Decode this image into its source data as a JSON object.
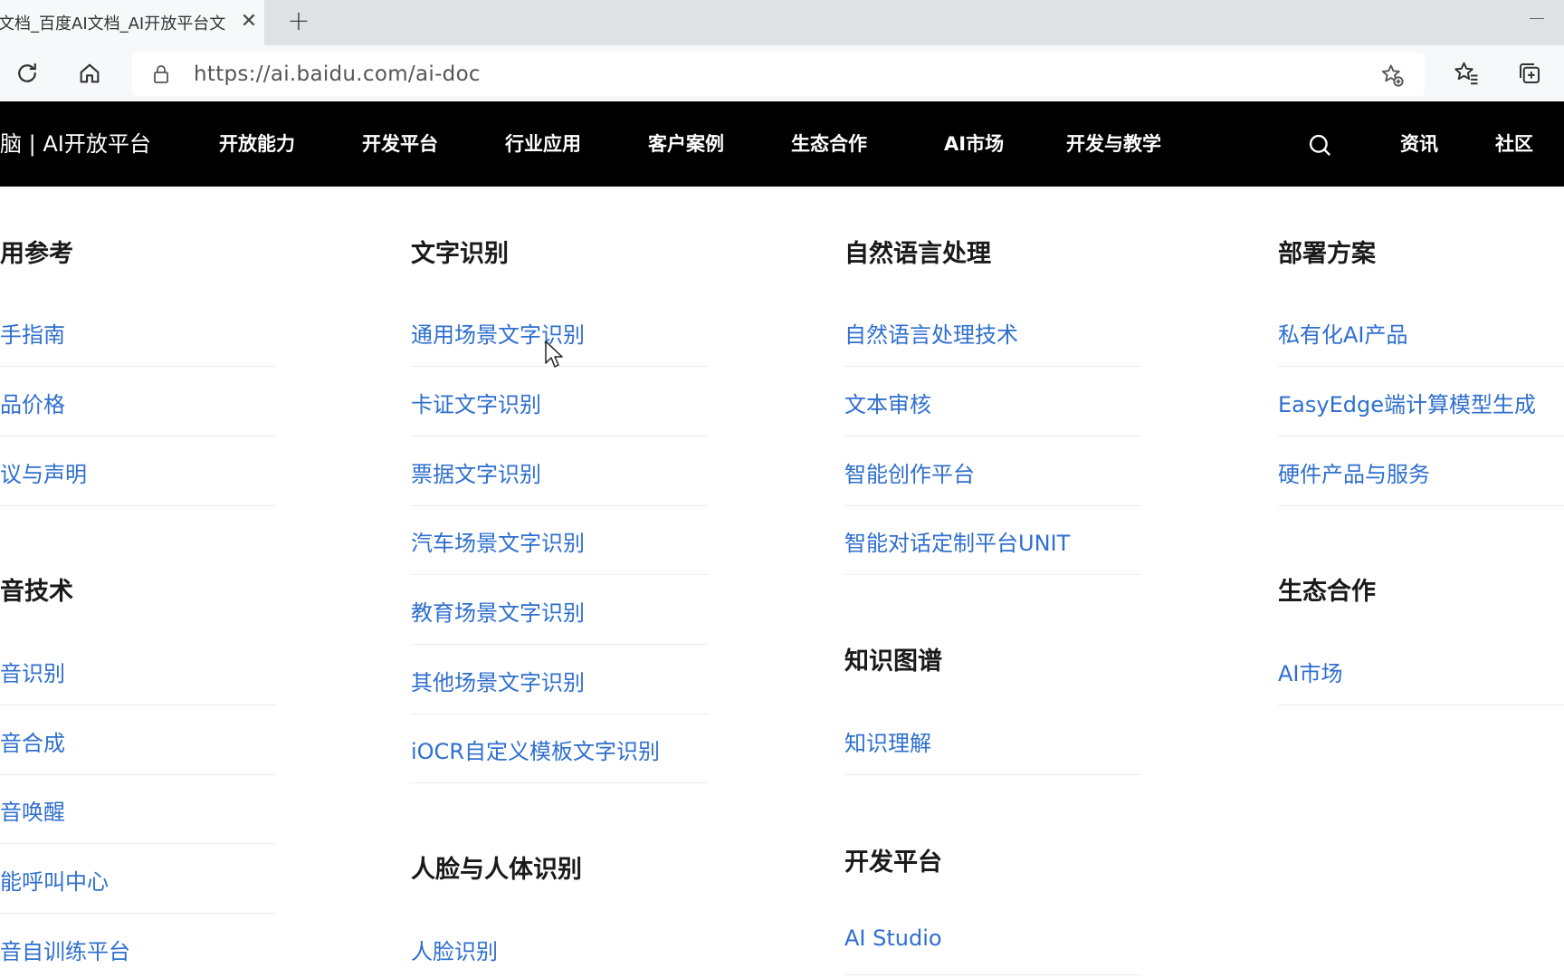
{
  "browser": {
    "tab_title": "文档_百度AI文档_AI开放平台文",
    "close_glyph": "✕",
    "new_tab_glyph": "+",
    "url": "https://ai.baidu.com/ai-doc"
  },
  "site_nav": {
    "brand": "脑 | AI开放平台",
    "items": [
      "开放能力",
      "开发平台",
      "行业应用",
      "客户案例",
      "生态合作",
      "AI市场",
      "开发与教学"
    ],
    "right_items": [
      "资讯",
      "社区"
    ]
  },
  "columns": {
    "col1": {
      "sections": [
        {
          "title": "用参考",
          "links": [
            "手指南",
            "品价格",
            "议与声明"
          ]
        },
        {
          "title": "音技术",
          "links": [
            "音识别",
            "音合成",
            "音唤醒",
            "能呼叫中心",
            "音自训练平台"
          ]
        }
      ]
    },
    "col2": {
      "sections": [
        {
          "title": "文字识别",
          "links": [
            "通用场景文字识别",
            "卡证文字识别",
            "票据文字识别",
            "汽车场景文字识别",
            "教育场景文字识别",
            "其他场景文字识别",
            "iOCR自定义模板文字识别"
          ]
        },
        {
          "title": "人脸与人体识别",
          "links": [
            "人脸识别"
          ]
        }
      ]
    },
    "col3": {
      "sections": [
        {
          "title": "自然语言处理",
          "links": [
            "自然语言处理技术",
            "文本审核",
            "智能创作平台",
            "智能对话定制平台UNIT"
          ]
        },
        {
          "title": "知识图谱",
          "links": [
            "知识理解"
          ]
        },
        {
          "title": "开发平台",
          "links": [
            "AI Studio"
          ]
        }
      ]
    },
    "col4": {
      "sections": [
        {
          "title": "部署方案",
          "links": [
            "私有化AI产品",
            "EasyEdge端计算模型生成",
            "硬件产品与服务"
          ]
        },
        {
          "title": "生态合作",
          "links": [
            "AI市场"
          ]
        }
      ]
    }
  }
}
